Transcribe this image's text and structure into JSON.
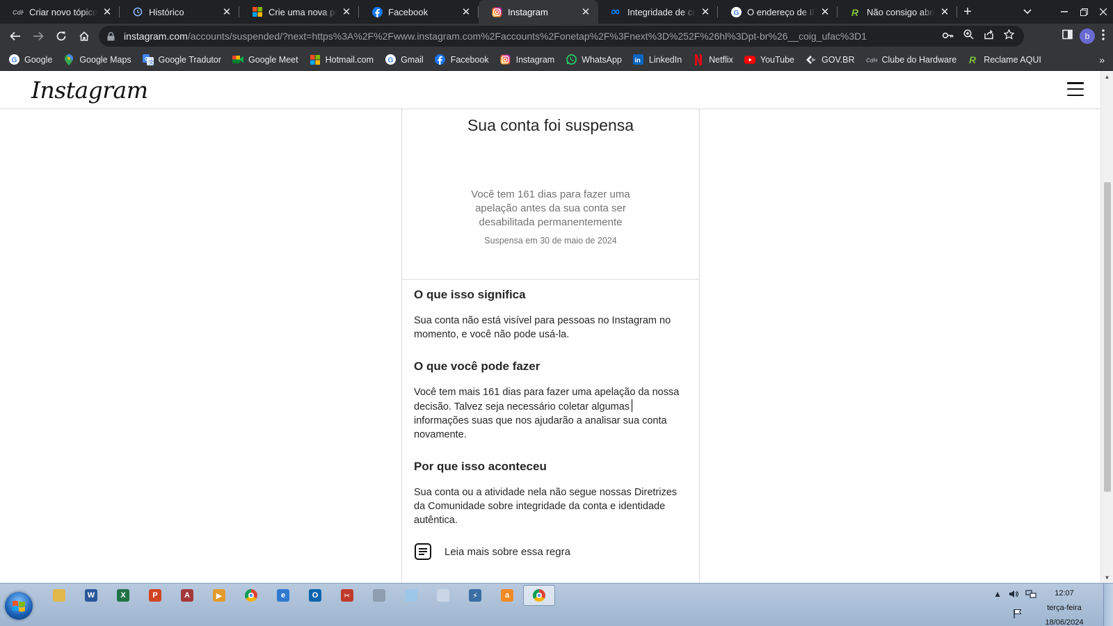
{
  "browser": {
    "tabs": [
      {
        "title": "Criar novo tópico - C",
        "icon": "clube-hardware-icon",
        "active": false
      },
      {
        "title": "Histórico",
        "icon": "history-icon",
        "active": false
      },
      {
        "title": "Crie uma nova pergunta",
        "icon": "microsoft-icon",
        "active": false
      },
      {
        "title": "Facebook",
        "icon": "facebook-icon",
        "active": false
      },
      {
        "title": "Instagram",
        "icon": "instagram-icon",
        "active": true
      },
      {
        "title": "Integridade de conta",
        "icon": "meta-icon",
        "active": false
      },
      {
        "title": "O endereço de IP que",
        "icon": "google-icon",
        "active": false
      },
      {
        "title": "Não consigo abrir um",
        "icon": "reclame-aqui-icon",
        "active": false
      }
    ],
    "url_host": "instagram.com",
    "url_path": "/accounts/suspended/?next=https%3A%2F%2Fwww.instagram.com%2Faccounts%2Fonetap%2F%3Fnext%3D%252F%26hl%3Dpt-br%26__coig_ufac%3D1",
    "profile_initial": "b",
    "bookmarks": [
      {
        "label": "Google",
        "icon": "google-icon"
      },
      {
        "label": "Google Maps",
        "icon": "maps-pin-icon"
      },
      {
        "label": "Google Tradutor",
        "icon": "translate-icon"
      },
      {
        "label": "Google Meet",
        "icon": "meet-icon"
      },
      {
        "label": "Hotmail.com",
        "icon": "microsoft-icon"
      },
      {
        "label": "Gmail",
        "icon": "google-icon"
      },
      {
        "label": "Facebook",
        "icon": "facebook-icon"
      },
      {
        "label": "Instagram",
        "icon": "instagram-icon"
      },
      {
        "label": "WhatsApp",
        "icon": "whatsapp-icon"
      },
      {
        "label": "LinkedIn",
        "icon": "linkedin-icon"
      },
      {
        "label": "Netflix",
        "icon": "netflix-icon"
      },
      {
        "label": "YouTube",
        "icon": "youtube-icon"
      },
      {
        "label": "GOV.BR",
        "icon": "govbr-icon"
      },
      {
        "label": "Clube do Hardware",
        "icon": "clube-hardware-icon"
      },
      {
        "label": "Reclame AQUI",
        "icon": "reclame-aqui-icon"
      }
    ]
  },
  "page": {
    "logo": "Instagram",
    "title": "Sua conta foi suspensa",
    "lead": "Você tem 161 dias para fazer uma apelação antes da sua conta ser desabilitada permanentemente",
    "suspended_date": "Suspensa em 30 de maio de 2024",
    "sections": [
      {
        "heading": "O que isso significa",
        "body": "Sua conta não está visível para pessoas no Instagram no momento, e você não pode usá-la."
      },
      {
        "heading": "O que você pode fazer",
        "body": "Você tem mais 161 dias para fazer uma apelação da nossa decisão. Talvez seja necessário coletar algumas informações suas que nos ajudarão a analisar sua conta novamente."
      },
      {
        "heading": "Por que isso aconteceu",
        "body": "Sua conta ou a atividade nela não segue nossas Diretrizes da Comunidade sobre integridade da conta e identidade autêntica."
      }
    ],
    "read_more": "Leia mais sobre essa regra"
  },
  "taskbar": {
    "apps": [
      {
        "icon": "file-explorer-icon",
        "color": "#e2b84a",
        "glyph": ""
      },
      {
        "icon": "word-icon",
        "color": "#2b579a",
        "glyph": "W"
      },
      {
        "icon": "excel-icon",
        "color": "#217346",
        "glyph": "X"
      },
      {
        "icon": "powerpoint-icon",
        "color": "#d04423",
        "glyph": "P"
      },
      {
        "icon": "access-icon",
        "color": "#a4373a",
        "glyph": "A"
      },
      {
        "icon": "media-player-icon",
        "color": "#e39a2c",
        "glyph": "▶"
      },
      {
        "icon": "chrome-icon",
        "color": "#db4437",
        "glyph": ""
      },
      {
        "icon": "internet-explorer-icon",
        "color": "#2f7ad0",
        "glyph": "e"
      },
      {
        "icon": "outlook-icon",
        "color": "#0a64ad",
        "glyph": "O"
      },
      {
        "icon": "snipping-tool-icon",
        "color": "#c0392b",
        "glyph": "✂"
      },
      {
        "icon": "network-tool-icon",
        "color": "#8e9db0",
        "glyph": ""
      },
      {
        "icon": "notepad-icon",
        "color": "#9cc7e8",
        "glyph": ""
      },
      {
        "icon": "document-icon",
        "color": "#c9d6e6",
        "glyph": ""
      },
      {
        "icon": "power-icon",
        "color": "#3a6ea5",
        "glyph": "⚡"
      },
      {
        "icon": "avast-icon",
        "color": "#f08a24",
        "glyph": "a"
      },
      {
        "icon": "chrome-icon",
        "color": "#db4437",
        "glyph": "",
        "active": true
      }
    ],
    "time": "12:07",
    "weekday": "terça-feira",
    "date": "18/06/2024"
  }
}
